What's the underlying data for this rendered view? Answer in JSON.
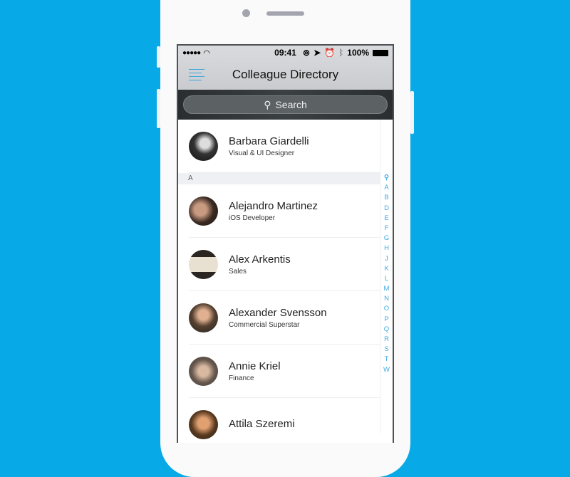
{
  "status": {
    "signal": "●●●●●",
    "time": "09:41",
    "battery": "100%"
  },
  "nav": {
    "title": "Colleague Directory"
  },
  "search": {
    "placeholder": "Search"
  },
  "featured": {
    "name": "Barbara Giardelli",
    "role": "Visual & UI Designer"
  },
  "section": "A",
  "contacts": [
    {
      "name": "Alejandro Martinez",
      "role": "iOS Developer"
    },
    {
      "name": "Alex Arkentis",
      "role": "Sales"
    },
    {
      "name": "Alexander Svensson",
      "role": "Commercial Superstar"
    },
    {
      "name": "Annie Kriel",
      "role": "Finance"
    },
    {
      "name": "Attila Szeremi",
      "role": ""
    }
  ],
  "index": [
    "A",
    "B",
    "D",
    "E",
    "F",
    "G",
    "H",
    "J",
    "K",
    "L",
    "M",
    "N",
    "O",
    "P",
    "Q",
    "R",
    "S",
    "T",
    "W"
  ],
  "colors": {
    "background": "#07a9e6",
    "accent": "#3fa8e0"
  }
}
